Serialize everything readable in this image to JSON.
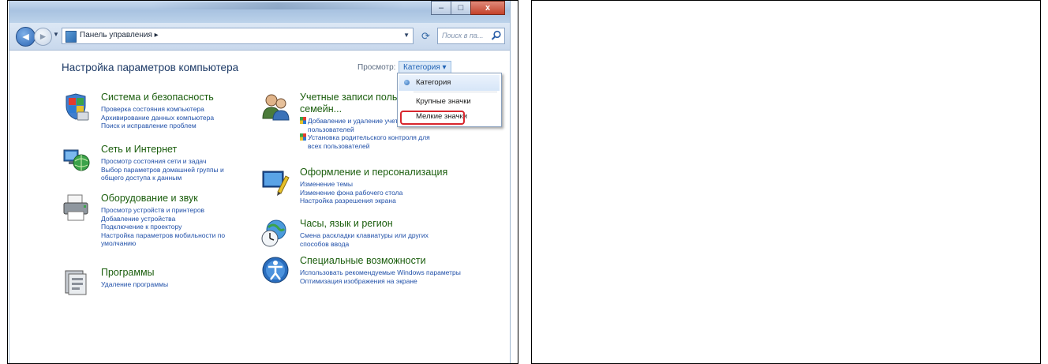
{
  "window": {
    "address": "Панель управления  ▸",
    "search_placeholder": "Поиск в па...",
    "minimize_glyph": "–",
    "maximize_glyph": "□",
    "close_glyph": "x"
  },
  "page": {
    "title": "Настройка параметров компьютера",
    "view_by_label": "Просмотр:",
    "view_by_value": "Категория ▾"
  },
  "view_menu": {
    "items": [
      "Категория",
      "Крупные значки",
      "Мелкие значки"
    ],
    "selected": "Категория",
    "highlighted": "Мелкие значки",
    "highlight_color": "#d8262d"
  },
  "categories_left": [
    {
      "title": "Система и безопасность",
      "icon": "shield-flag-icon",
      "links": [
        "Проверка состояния компьютера",
        "Архивирование данных компьютера",
        "Поиск и исправление проблем"
      ]
    },
    {
      "title": "Сеть и Интернет",
      "icon": "network-globe-icon",
      "links": [
        "Просмотр состояния сети и задач",
        "Выбор параметров домашней группы и",
        "общего доступа к данным"
      ]
    },
    {
      "title": "Оборудование и звук",
      "icon": "printer-icon",
      "links": [
        "Просмотр устройств и принтеров",
        "Добавление устройства",
        "Подключение к проектору",
        "Настройка параметров мобильности по",
        "умолчанию"
      ]
    },
    {
      "title": "Программы",
      "icon": "programs-icon",
      "links": [
        "Удаление программы"
      ]
    }
  ],
  "categories_right": [
    {
      "title": "Учетные записи пользователей и",
      "title2": "семейн...",
      "icon": "users-icon",
      "links": [
        "Добавление и удаление учетных записей",
        "пользователей",
        "Установка родительского контроля для",
        "всех пользователей"
      ],
      "shield_links": [
        0,
        2
      ]
    },
    {
      "title": "Оформление и персонализация",
      "icon": "appearance-icon",
      "links": [
        "Изменение темы",
        "Изменение фона рабочего стола",
        "Настройка разрешения экрана"
      ]
    },
    {
      "title": "Часы, язык и регион",
      "icon": "clock-globe-icon",
      "links": [
        "Смена раскладки клавиатуры или других",
        "способов ввода"
      ]
    },
    {
      "title": "Специальные возможности",
      "icon": "accessibility-icon",
      "links": [
        "Использовать рекомендуемые Windows параметры",
        "Оптимизация изображения на экране"
      ]
    }
  ],
  "colors": {
    "category_title": "#1a5d0c",
    "link": "#1f4fa8",
    "page_title": "#1d3a66"
  }
}
